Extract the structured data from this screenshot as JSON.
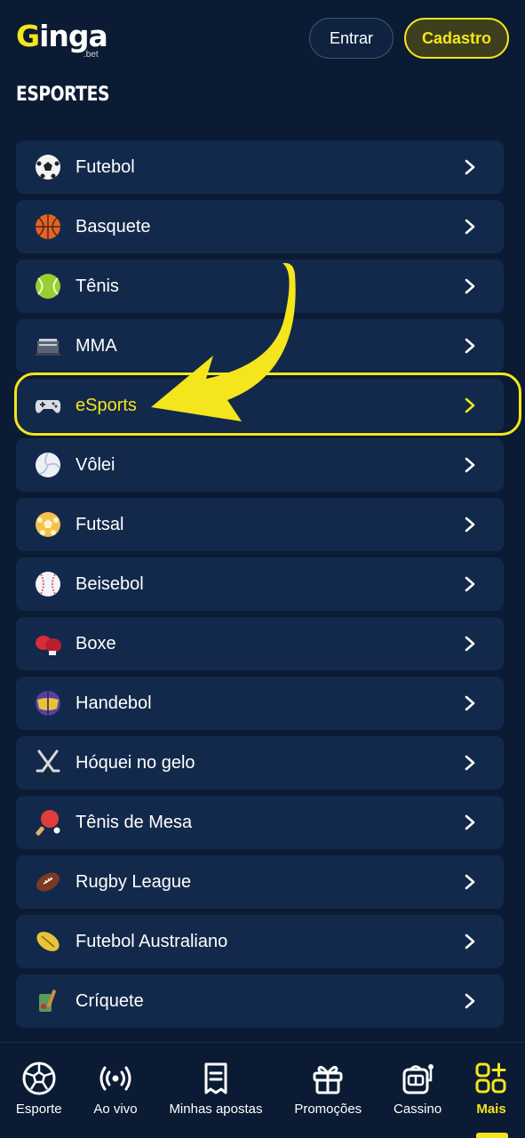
{
  "header": {
    "logo_text": "Ginga",
    "logo_sub": ".bet",
    "login_label": "Entrar",
    "signup_label": "Cadastro"
  },
  "section_title": "ESPORTES",
  "sports": [
    {
      "label": "Futebol",
      "icon": "soccer-ball-icon"
    },
    {
      "label": "Basquete",
      "icon": "basketball-icon"
    },
    {
      "label": "Tênis",
      "icon": "tennis-ball-icon"
    },
    {
      "label": "MMA",
      "icon": "mma-ring-icon"
    },
    {
      "label": "eSports",
      "icon": "gamepad-icon",
      "highlighted": true
    },
    {
      "label": "Vôlei",
      "icon": "volleyball-icon"
    },
    {
      "label": "Futsal",
      "icon": "futsal-ball-icon"
    },
    {
      "label": "Beisebol",
      "icon": "baseball-icon"
    },
    {
      "label": "Boxe",
      "icon": "boxing-glove-icon"
    },
    {
      "label": "Handebol",
      "icon": "handball-icon"
    },
    {
      "label": "Hóquei no gelo",
      "icon": "hockey-sticks-icon"
    },
    {
      "label": "Tênis de Mesa",
      "icon": "ping-pong-icon"
    },
    {
      "label": "Rugby League",
      "icon": "rugby-ball-icon"
    },
    {
      "label": "Futebol Australiano",
      "icon": "aussie-football-icon"
    },
    {
      "label": "Críquete",
      "icon": "cricket-icon"
    }
  ],
  "bottom_nav": [
    {
      "label": "Esporte",
      "icon": "soccer-ball-icon"
    },
    {
      "label": "Ao vivo",
      "icon": "live-broadcast-icon"
    },
    {
      "label": "Minhas apostas",
      "icon": "receipt-icon"
    },
    {
      "label": "Promoções",
      "icon": "gift-icon"
    },
    {
      "label": "Cassino",
      "icon": "slot-machine-icon"
    },
    {
      "label": "Mais",
      "icon": "grid-plus-icon",
      "active": true
    }
  ],
  "colors": {
    "background": "#0b1b33",
    "card": "#13294b",
    "accent": "#f4e51c"
  }
}
